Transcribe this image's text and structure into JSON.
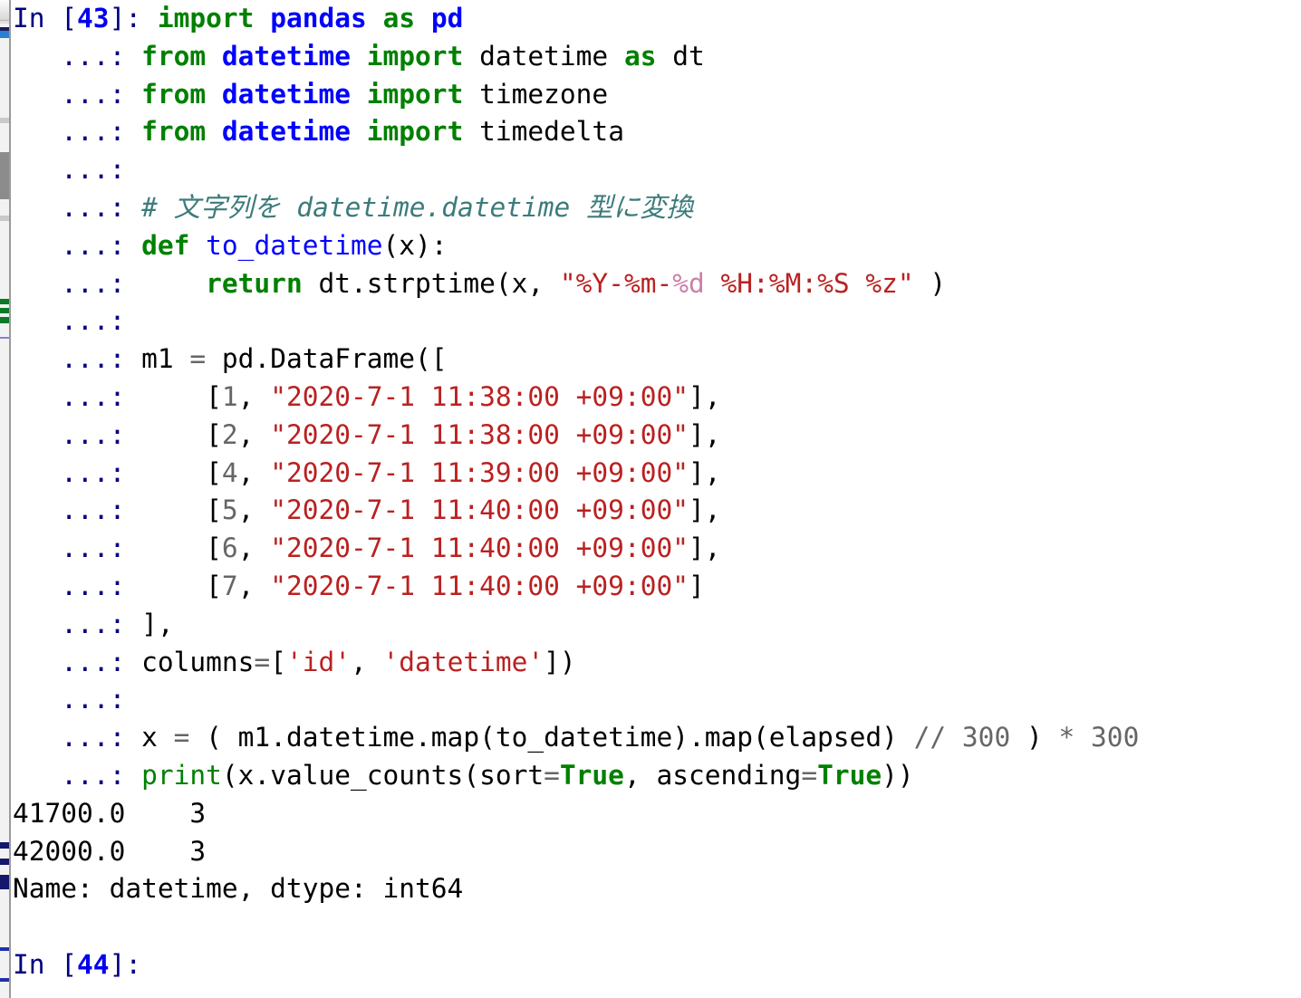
{
  "terminal": {
    "kind": "ipython-console",
    "background_color": "#ffffff",
    "colors": {
      "prompt": "#000080",
      "prompt_number": "#0000ee",
      "keyword": "#008000",
      "module": "#0000ff",
      "string": "#ba2121",
      "string_format": "#cb7fa8",
      "number": "#666666",
      "operator": "#666666",
      "comment": "#3d7b7b",
      "builtin": "#008000",
      "output": "#000000"
    },
    "prompts": {
      "in_open": "In [",
      "in_close": "]:",
      "continuation": "   ...:",
      "current_number": "43",
      "next_number": "44"
    },
    "lines": [
      {
        "prompt": "in",
        "tokens": [
          {
            "t": "import",
            "c": "kw"
          },
          {
            "t": " ",
            "c": "plain"
          },
          {
            "t": "pandas",
            "c": "mod"
          },
          {
            "t": " ",
            "c": "plain"
          },
          {
            "t": "as",
            "c": "kw"
          },
          {
            "t": " ",
            "c": "plain"
          },
          {
            "t": "pd",
            "c": "mod"
          }
        ]
      },
      {
        "prompt": "cont",
        "tokens": [
          {
            "t": "from",
            "c": "kw"
          },
          {
            "t": " ",
            "c": "plain"
          },
          {
            "t": "datetime",
            "c": "mod"
          },
          {
            "t": " ",
            "c": "plain"
          },
          {
            "t": "import",
            "c": "kw"
          },
          {
            "t": " ",
            "c": "plain"
          },
          {
            "t": "datetime",
            "c": "plain"
          },
          {
            "t": " ",
            "c": "plain"
          },
          {
            "t": "as",
            "c": "kw"
          },
          {
            "t": " ",
            "c": "plain"
          },
          {
            "t": "dt",
            "c": "plain"
          }
        ]
      },
      {
        "prompt": "cont",
        "tokens": [
          {
            "t": "from",
            "c": "kw"
          },
          {
            "t": " ",
            "c": "plain"
          },
          {
            "t": "datetime",
            "c": "mod"
          },
          {
            "t": " ",
            "c": "plain"
          },
          {
            "t": "import",
            "c": "kw"
          },
          {
            "t": " ",
            "c": "plain"
          },
          {
            "t": "timezone",
            "c": "plain"
          }
        ]
      },
      {
        "prompt": "cont",
        "tokens": [
          {
            "t": "from",
            "c": "kw"
          },
          {
            "t": " ",
            "c": "plain"
          },
          {
            "t": "datetime",
            "c": "mod"
          },
          {
            "t": " ",
            "c": "plain"
          },
          {
            "t": "import",
            "c": "kw"
          },
          {
            "t": " ",
            "c": "plain"
          },
          {
            "t": "timedelta",
            "c": "plain"
          }
        ]
      },
      {
        "prompt": "cont",
        "tokens": []
      },
      {
        "prompt": "cont",
        "tokens": [
          {
            "t": "# 文字列を datetime.datetime 型に変換",
            "c": "comment"
          }
        ]
      },
      {
        "prompt": "cont",
        "tokens": [
          {
            "t": "def",
            "c": "kw"
          },
          {
            "t": " ",
            "c": "plain"
          },
          {
            "t": "to_datetime",
            "c": "name"
          },
          {
            "t": "(x):",
            "c": "plain"
          }
        ]
      },
      {
        "prompt": "cont",
        "tokens": [
          {
            "t": "    ",
            "c": "plain"
          },
          {
            "t": "return",
            "c": "kw"
          },
          {
            "t": " ",
            "c": "plain"
          },
          {
            "t": "dt.strptime(x, ",
            "c": "plain"
          },
          {
            "t": "\"%Y-%m-",
            "c": "str"
          },
          {
            "t": "%d",
            "c": "strfmt"
          },
          {
            "t": " %H:%M:%S %z\"",
            "c": "str"
          },
          {
            "t": " )",
            "c": "plain"
          }
        ]
      },
      {
        "prompt": "cont",
        "tokens": []
      },
      {
        "prompt": "cont",
        "tokens": [
          {
            "t": "m1 ",
            "c": "plain"
          },
          {
            "t": "=",
            "c": "op"
          },
          {
            "t": " pd.DataFrame([",
            "c": "plain"
          }
        ]
      },
      {
        "prompt": "cont",
        "tokens": [
          {
            "t": "    [",
            "c": "plain"
          },
          {
            "t": "1",
            "c": "num"
          },
          {
            "t": ", ",
            "c": "plain"
          },
          {
            "t": "\"2020-7-1 11:38:00 +09:00\"",
            "c": "str"
          },
          {
            "t": "],",
            "c": "plain"
          }
        ]
      },
      {
        "prompt": "cont",
        "tokens": [
          {
            "t": "    [",
            "c": "plain"
          },
          {
            "t": "2",
            "c": "num"
          },
          {
            "t": ", ",
            "c": "plain"
          },
          {
            "t": "\"2020-7-1 11:38:00 +09:00\"",
            "c": "str"
          },
          {
            "t": "],",
            "c": "plain"
          }
        ]
      },
      {
        "prompt": "cont",
        "tokens": [
          {
            "t": "    [",
            "c": "plain"
          },
          {
            "t": "4",
            "c": "num"
          },
          {
            "t": ", ",
            "c": "plain"
          },
          {
            "t": "\"2020-7-1 11:39:00 +09:00\"",
            "c": "str"
          },
          {
            "t": "],",
            "c": "plain"
          }
        ]
      },
      {
        "prompt": "cont",
        "tokens": [
          {
            "t": "    [",
            "c": "plain"
          },
          {
            "t": "5",
            "c": "num"
          },
          {
            "t": ", ",
            "c": "plain"
          },
          {
            "t": "\"2020-7-1 11:40:00 +09:00\"",
            "c": "str"
          },
          {
            "t": "],",
            "c": "plain"
          }
        ]
      },
      {
        "prompt": "cont",
        "tokens": [
          {
            "t": "    [",
            "c": "plain"
          },
          {
            "t": "6",
            "c": "num"
          },
          {
            "t": ", ",
            "c": "plain"
          },
          {
            "t": "\"2020-7-1 11:40:00 +09:00\"",
            "c": "str"
          },
          {
            "t": "],",
            "c": "plain"
          }
        ]
      },
      {
        "prompt": "cont",
        "tokens": [
          {
            "t": "    [",
            "c": "plain"
          },
          {
            "t": "7",
            "c": "num"
          },
          {
            "t": ", ",
            "c": "plain"
          },
          {
            "t": "\"2020-7-1 11:40:00 +09:00\"",
            "c": "str"
          },
          {
            "t": "]",
            "c": "plain"
          }
        ]
      },
      {
        "prompt": "cont",
        "tokens": [
          {
            "t": "],",
            "c": "plain"
          }
        ]
      },
      {
        "prompt": "cont",
        "tokens": [
          {
            "t": "columns",
            "c": "plain"
          },
          {
            "t": "=",
            "c": "op"
          },
          {
            "t": "[",
            "c": "plain"
          },
          {
            "t": "'id'",
            "c": "str"
          },
          {
            "t": ", ",
            "c": "plain"
          },
          {
            "t": "'datetime'",
            "c": "str"
          },
          {
            "t": "])",
            "c": "plain"
          }
        ]
      },
      {
        "prompt": "cont",
        "tokens": []
      },
      {
        "prompt": "cont",
        "tokens": [
          {
            "t": "x ",
            "c": "plain"
          },
          {
            "t": "=",
            "c": "op"
          },
          {
            "t": " ( m1.datetime.map(to_datetime).map(elapsed) ",
            "c": "plain"
          },
          {
            "t": "//",
            "c": "op"
          },
          {
            "t": " ",
            "c": "plain"
          },
          {
            "t": "300",
            "c": "num"
          },
          {
            "t": " )",
            "c": "plain"
          },
          {
            "t": " ",
            "c": "plain"
          },
          {
            "t": "*",
            "c": "op"
          },
          {
            "t": " ",
            "c": "plain"
          },
          {
            "t": "300",
            "c": "num"
          }
        ]
      },
      {
        "prompt": "cont",
        "tokens": [
          {
            "t": "print",
            "c": "builtin"
          },
          {
            "t": "(x.value_counts(sort",
            "c": "plain"
          },
          {
            "t": "=",
            "c": "op"
          },
          {
            "t": "True",
            "c": "kwconst"
          },
          {
            "t": ", ascending",
            "c": "plain"
          },
          {
            "t": "=",
            "c": "op"
          },
          {
            "t": "True",
            "c": "kwconst"
          },
          {
            "t": "))",
            "c": "plain"
          }
        ]
      },
      {
        "prompt": "none",
        "tokens": [
          {
            "t": "41700.0    3",
            "c": "out"
          }
        ]
      },
      {
        "prompt": "none",
        "tokens": [
          {
            "t": "42000.0    3",
            "c": "out"
          }
        ]
      },
      {
        "prompt": "none",
        "tokens": [
          {
            "t": "Name: datetime, dtype: int64",
            "c": "out"
          }
        ]
      },
      {
        "prompt": "none",
        "tokens": []
      },
      {
        "prompt": "in-next",
        "tokens": []
      }
    ],
    "output": {
      "value_counts": [
        {
          "value": "41700.0",
          "count": "3"
        },
        {
          "value": "42000.0",
          "count": "3"
        }
      ],
      "footer": "Name: datetime, dtype: int64"
    },
    "source_text": "import pandas as pd\nfrom datetime import datetime as dt\nfrom datetime import timezone\nfrom datetime import timedelta\n\n# 文字列を datetime.datetime 型に変換\ndef to_datetime(x):\n    return dt.strptime(x, \"%Y-%m-%d %H:%M:%S %z\" )\n\nm1 = pd.DataFrame([\n    [1, \"2020-7-1 11:38:00 +09:00\"],\n    [2, \"2020-7-1 11:38:00 +09:00\"],\n    [4, \"2020-7-1 11:39:00 +09:00\"],\n    [5, \"2020-7-1 11:40:00 +09:00\"],\n    [6, \"2020-7-1 11:40:00 +09:00\"],\n    [7, \"2020-7-1 11:40:00 +09:00\"]\n],\ncolumns=['id', 'datetime'])\n\nx = ( m1.datetime.map(to_datetime).map(elapsed) // 300 ) * 300\nprint(x.value_counts(sort=True, ascending=True))"
  }
}
